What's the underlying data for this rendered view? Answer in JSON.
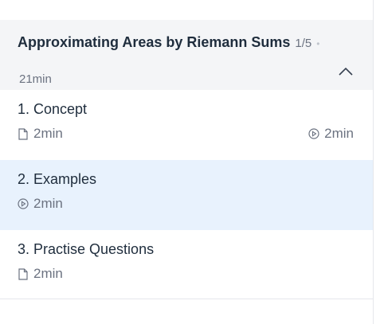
{
  "section": {
    "title": "Approximating Areas by Riemann Sums",
    "progress": "1/5",
    "separator": "•",
    "duration": "21min",
    "collapse_icon": "chevron-up-icon"
  },
  "lessons": [
    {
      "title": "1. Concept",
      "reading": {
        "icon": "document-icon",
        "duration": "2min"
      },
      "video": {
        "icon": "play-circle-icon",
        "duration": "2min"
      },
      "active": false
    },
    {
      "title": "2. Examples",
      "video": {
        "icon": "play-circle-icon",
        "duration": "2min"
      },
      "active": true
    },
    {
      "title": "3. Practise Questions",
      "reading": {
        "icon": "document-icon",
        "duration": "2min"
      },
      "active": false
    }
  ],
  "colors": {
    "header_bg": "#f4f5f7",
    "active_bg": "#e8f2fd",
    "title_text": "#1f2d3d",
    "muted_text": "#6b7280"
  }
}
